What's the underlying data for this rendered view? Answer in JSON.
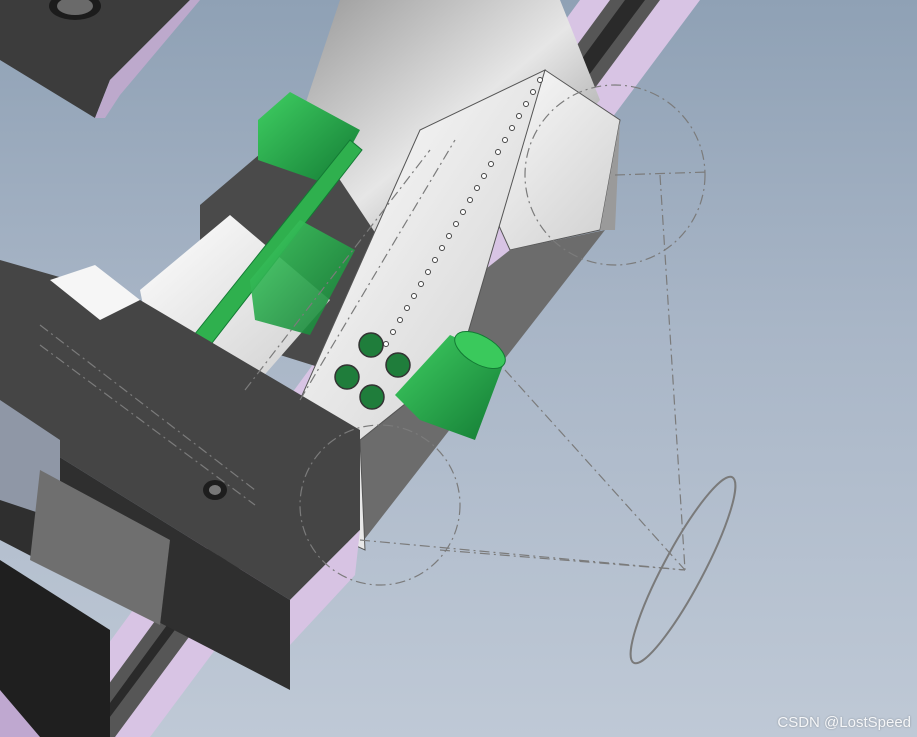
{
  "viewport": {
    "background_top": "#8fa1b5",
    "background_bottom": "#bfc9d6",
    "model": "cad-assembly-isometric-view"
  },
  "colors": {
    "green_part": "#2fb04e",
    "green_dark": "#16823a",
    "dark_steel": "#3d3d3d",
    "white_part": "#f4f4f4",
    "rail_lilac": "#d7c3e3",
    "sketch_line": "#7b7b7b"
  },
  "watermark": {
    "text": "CSDN @LostSpeed"
  }
}
